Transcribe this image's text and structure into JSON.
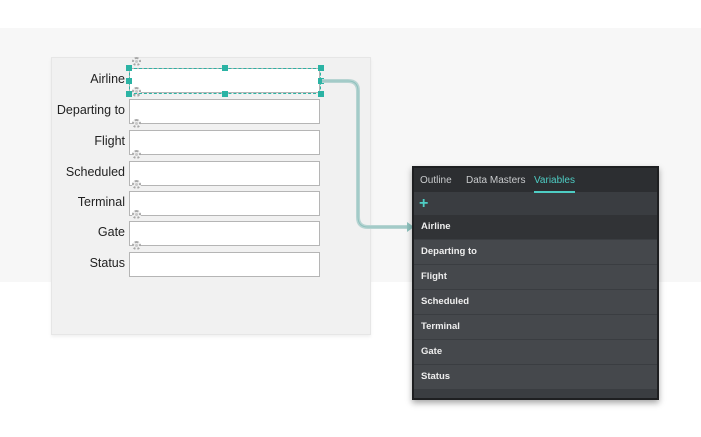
{
  "form": {
    "fields": [
      {
        "label": "Airline"
      },
      {
        "label": "Departing to"
      },
      {
        "label": "Flight"
      },
      {
        "label": "Scheduled"
      },
      {
        "label": "Terminal"
      },
      {
        "label": "Gate"
      },
      {
        "label": "Status"
      }
    ]
  },
  "panel": {
    "tabs": [
      {
        "label": "Outline",
        "active": false
      },
      {
        "label": "Data Masters",
        "active": false
      },
      {
        "label": "Variables",
        "active": true
      }
    ],
    "add_icon": "+",
    "variables": [
      {
        "label": "Airline",
        "selected": true
      },
      {
        "label": "Departing to",
        "selected": false
      },
      {
        "label": "Flight",
        "selected": false
      },
      {
        "label": "Scheduled",
        "selected": false
      },
      {
        "label": "Terminal",
        "selected": false
      },
      {
        "label": "Gate",
        "selected": false
      },
      {
        "label": "Status",
        "selected": false
      }
    ]
  },
  "colors": {
    "accent": "#4ecdc4",
    "selection": "#2bb3a4",
    "panel_bg": "#3a3d41"
  }
}
